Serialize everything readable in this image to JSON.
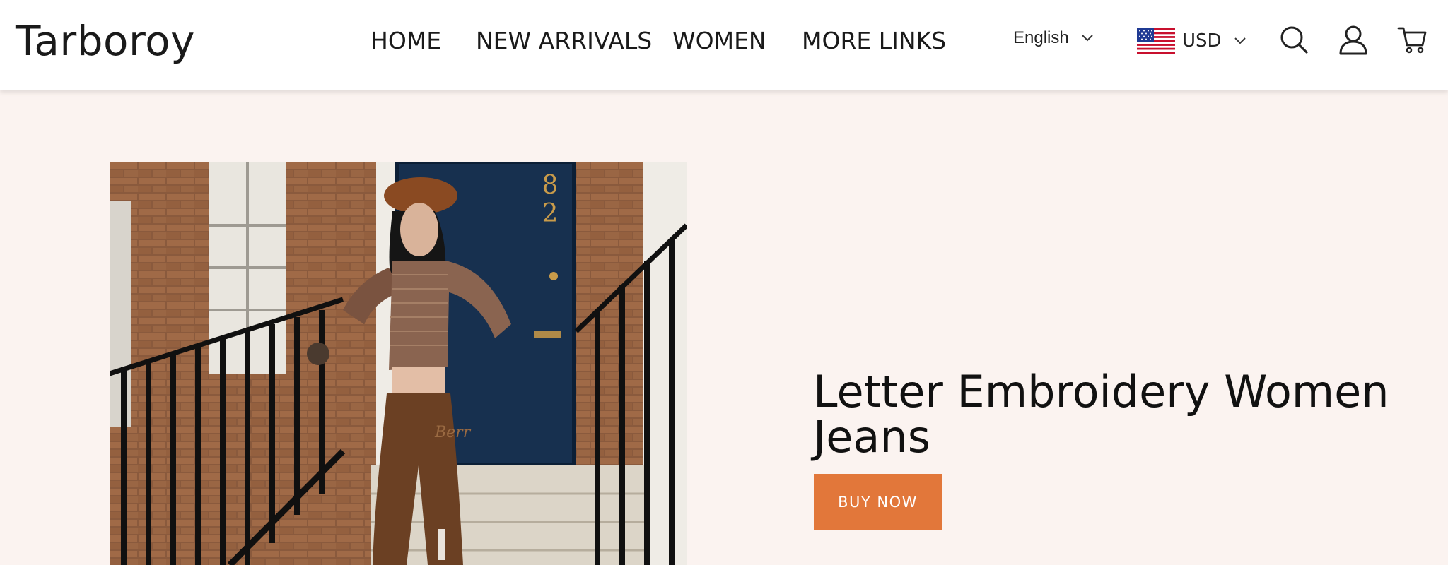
{
  "header": {
    "logo": "Tarboroy",
    "nav": {
      "home": "HOME",
      "new_arrivals": "NEW ARRIVALS",
      "women": "WOMEN",
      "more_links": "MORE LINKS"
    },
    "language": {
      "selected": "English",
      "icon": "chevron-down-icon"
    },
    "currency": {
      "selected": "USD",
      "flag": "us-flag-icon",
      "icon": "chevron-down-icon"
    },
    "icons": [
      "search-icon",
      "user-icon",
      "cart-icon"
    ]
  },
  "hero": {
    "image": "model-photo",
    "headline": "Letter Embroidery Women Jeans",
    "button_label": "BUY NOW",
    "colors": {
      "background": "#fbf3f0",
      "button": "#e2773a"
    }
  }
}
